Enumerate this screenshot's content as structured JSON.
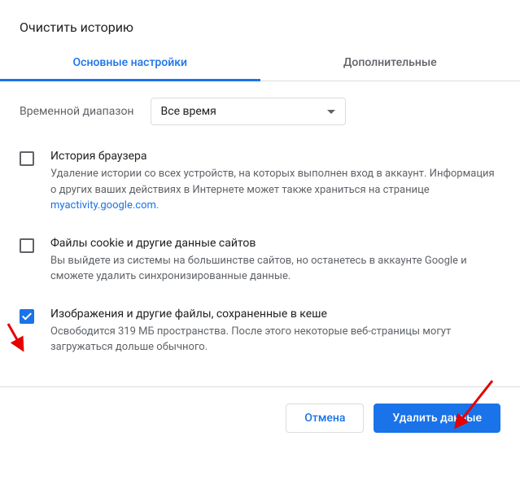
{
  "dialog": {
    "title": "Очистить историю"
  },
  "tabs": {
    "basic": "Основные настройки",
    "advanced": "Дополнительные"
  },
  "timeRange": {
    "label": "Временной диапазон",
    "selected": "Все время"
  },
  "items": [
    {
      "checked": false,
      "title": "История браузера",
      "desc_before": "Удаление истории со всех устройств, на которых выполнен вход в аккаунт. Информация о других ваших действиях в Интернете может также храниться на странице ",
      "link_text": "myactivity.google.com",
      "desc_after": "."
    },
    {
      "checked": false,
      "title": "Файлы cookie и другие данные сайтов",
      "desc": "Вы выйдете из системы на большинстве сайтов, но останетесь в аккаунте Google и сможете удалить синхронизированные данные."
    },
    {
      "checked": true,
      "title": "Изображения и другие файлы, сохраненные в кеше",
      "desc": "Освободится 319 МБ пространства. После этого некоторые веб-страницы могут загружаться дольше обычного."
    }
  ],
  "buttons": {
    "cancel": "Отмена",
    "clear": "Удалить данные"
  }
}
